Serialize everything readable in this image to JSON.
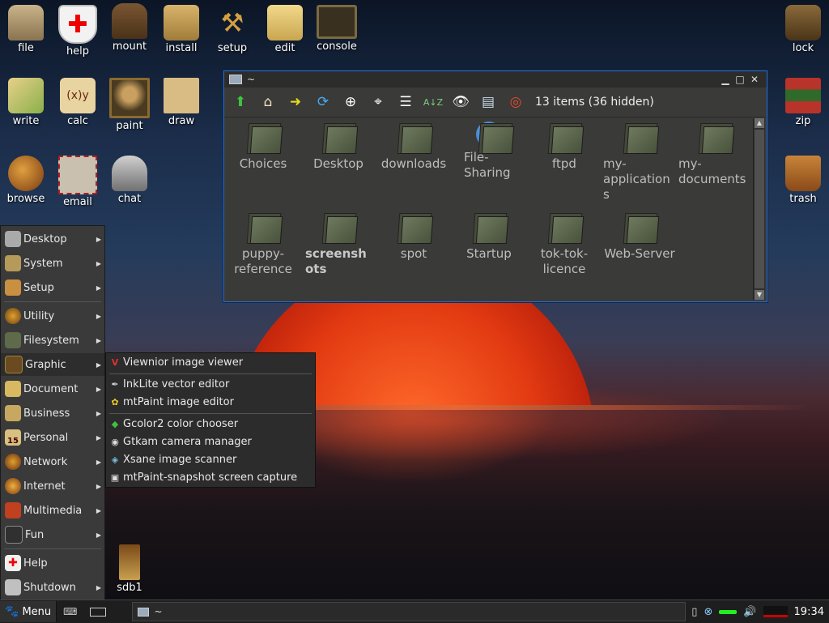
{
  "desktop": {
    "icons": [
      {
        "label": "file",
        "icon": "colosseum-icon"
      },
      {
        "label": "help",
        "icon": "red-cross-shield-icon"
      },
      {
        "label": "mount",
        "icon": "chest-icon"
      },
      {
        "label": "install",
        "icon": "scroll-icon"
      },
      {
        "label": "setup",
        "icon": "crossed-tools-icon"
      },
      {
        "label": "edit",
        "icon": "parchment-icon"
      },
      {
        "label": "console",
        "icon": "monitor-icon"
      },
      {
        "label": "lock",
        "icon": "keyhole-icon"
      },
      {
        "label": "write",
        "icon": "quill-icon"
      },
      {
        "label": "calc",
        "icon": "formula-scroll-icon"
      },
      {
        "label": "paint",
        "icon": "mona-lisa-icon"
      },
      {
        "label": "draw",
        "icon": "vitruvian-icon"
      },
      {
        "label": "zip",
        "icon": "books-icon"
      },
      {
        "label": "browse",
        "icon": "globe-icon"
      },
      {
        "label": "email",
        "icon": "stamp-icon"
      },
      {
        "label": "chat",
        "icon": "knight-helmet-icon"
      },
      {
        "label": "trash",
        "icon": "bucket-icon"
      },
      {
        "label": "sdb1",
        "icon": "drive-icon"
      }
    ]
  },
  "window": {
    "title": "~",
    "status": "13 items (36 hidden)",
    "controls": {
      "minimize": "▁",
      "maximize": "□",
      "close": "✕"
    },
    "toolbar_icons": [
      "up-arrow-icon",
      "home-icon",
      "go-icon",
      "refresh-icon",
      "zoom-in-icon",
      "target-icon",
      "list-view-icon",
      "sort-az-icon",
      "eye-icon",
      "detail-view-icon",
      "lifebuoy-icon"
    ],
    "items": [
      {
        "name": "Choices",
        "type": "folder"
      },
      {
        "name": "Desktop",
        "type": "folder"
      },
      {
        "name": "downloads",
        "type": "folder"
      },
      {
        "name": "File-Sharing",
        "display": "File-\nSharing",
        "type": "special"
      },
      {
        "name": "ftpd",
        "type": "folder"
      },
      {
        "name": "my-applications",
        "display": "my-\napplication\ns",
        "type": "folder"
      },
      {
        "name": "my-documents",
        "display": "my-\ndocuments",
        "type": "folder"
      },
      {
        "name": "puppy-reference",
        "display": "puppy-\nreference",
        "type": "folder"
      },
      {
        "name": "screenshots",
        "display": "screensh\nots",
        "type": "folder",
        "bold": true
      },
      {
        "name": "spot",
        "type": "folder"
      },
      {
        "name": "Startup",
        "type": "folder"
      },
      {
        "name": "tok-tok-licence",
        "display": "tok-tok-\nlicence",
        "type": "folder"
      },
      {
        "name": "Web-Server",
        "type": "folder"
      }
    ]
  },
  "start_menu": {
    "items": [
      {
        "label": "Desktop",
        "icon": "tools-icon",
        "submenu": true
      },
      {
        "label": "System",
        "icon": "monitor-icon",
        "submenu": true
      },
      {
        "label": "Setup",
        "icon": "crossed-tools-icon",
        "submenu": true
      },
      {
        "label": "Utility",
        "icon": "gear-icon",
        "submenu": true
      },
      {
        "label": "Filesystem",
        "icon": "folder-icon",
        "submenu": true
      },
      {
        "label": "Graphic",
        "icon": "picture-icon",
        "submenu": true,
        "active": true
      },
      {
        "label": "Document",
        "icon": "document-icon",
        "submenu": true
      },
      {
        "label": "Business",
        "icon": "ledger-icon",
        "submenu": true
      },
      {
        "label": "Personal",
        "icon": "calendar-icon",
        "submenu": true
      },
      {
        "label": "Network",
        "icon": "network-icon",
        "submenu": true
      },
      {
        "label": "Internet",
        "icon": "globe-icon",
        "submenu": true
      },
      {
        "label": "Multimedia",
        "icon": "multimedia-icon",
        "submenu": true
      },
      {
        "label": "Fun",
        "icon": "game-icon",
        "submenu": true
      },
      {
        "label": "Help",
        "icon": "red-cross-shield-icon",
        "submenu": false
      },
      {
        "label": "Shutdown",
        "icon": "shield-icon",
        "submenu": true
      }
    ],
    "calendar_badge": "15"
  },
  "graphic_submenu": {
    "items": [
      {
        "label": "Viewnior image viewer",
        "icon": "viewnior-icon"
      },
      {
        "label": "InkLite vector editor",
        "icon": "inklite-icon"
      },
      {
        "label": "mtPaint image editor",
        "icon": "mtpaint-icon"
      },
      {
        "label": "Gcolor2 color chooser",
        "icon": "gcolor-icon"
      },
      {
        "label": "Gtkam camera manager",
        "icon": "camera-icon"
      },
      {
        "label": "Xsane image scanner",
        "icon": "scanner-icon"
      },
      {
        "label": "mtPaint-snapshot screen capture",
        "icon": "snapshot-icon"
      }
    ]
  },
  "taskbar": {
    "menu_label": "Menu",
    "task_label": "~",
    "clock": "19:34"
  },
  "colors": {
    "window_border": "#2a6ccc",
    "window_bg": "#3a3a38",
    "menu_bg": "#3a3a3a",
    "sun": "#e23a12"
  }
}
